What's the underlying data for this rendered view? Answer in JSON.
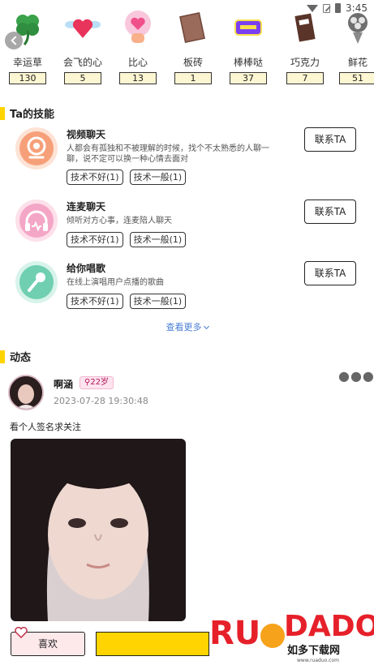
{
  "status_bar": {
    "time": "3:45"
  },
  "gifts": [
    {
      "name": "幸运草",
      "count": "130",
      "icon": "clover-icon"
    },
    {
      "name": "会飞的心",
      "count": "5",
      "icon": "winged-heart-icon"
    },
    {
      "name": "比心",
      "count": "13",
      "icon": "heart-hand-icon"
    },
    {
      "name": "板砖",
      "count": "1",
      "icon": "brick-icon"
    },
    {
      "name": "棒棒哒",
      "count": "37",
      "icon": "awesome-sticker-icon"
    },
    {
      "name": "巧克力",
      "count": "7",
      "icon": "chocolate-icon"
    },
    {
      "name": "鲜花",
      "count": "51",
      "icon": "bouquet-icon"
    }
  ],
  "skills_section": {
    "title": "Ta的技能",
    "contact_label": "联系TA",
    "items": [
      {
        "title": "视频聊天",
        "desc": "人都会有孤独和不被理解的时候，找个不太熟悉的人聊一聊，说不定可以换一种心情去面对",
        "tags": [
          "技术不好(1)",
          "技术一般(1)"
        ],
        "icon": "webcam-icon",
        "color": "#f6a07a"
      },
      {
        "title": "连麦聊天",
        "desc": "倾听对方心事，连麦陪人聊天",
        "tags": [
          "技术不好(1)",
          "技术一般(1)"
        ],
        "icon": "headphones-icon",
        "color": "#f4a6c6"
      },
      {
        "title": "给你唱歌",
        "desc": "在线上演唱用户点播的歌曲",
        "tags": [
          "技术不好(1)",
          "技术一般(1)"
        ],
        "icon": "microphone-icon",
        "color": "#6fcfb0"
      }
    ],
    "see_more": "查看更多"
  },
  "moments_section": {
    "title": "动态",
    "post": {
      "username": "啊涵",
      "age": "22岁",
      "time": "2023-07-28 19:30:48",
      "text": "看个人签名求关注"
    }
  },
  "actions": {
    "like_label": "喜欢"
  },
  "watermark": {
    "brand": "RUANDUO",
    "site": "如多下载网",
    "url": "www.ruaduo.com"
  },
  "colors": {
    "accent": "#ffd400",
    "link": "#4a7fd4",
    "count_bg": "#fdf6d2"
  }
}
